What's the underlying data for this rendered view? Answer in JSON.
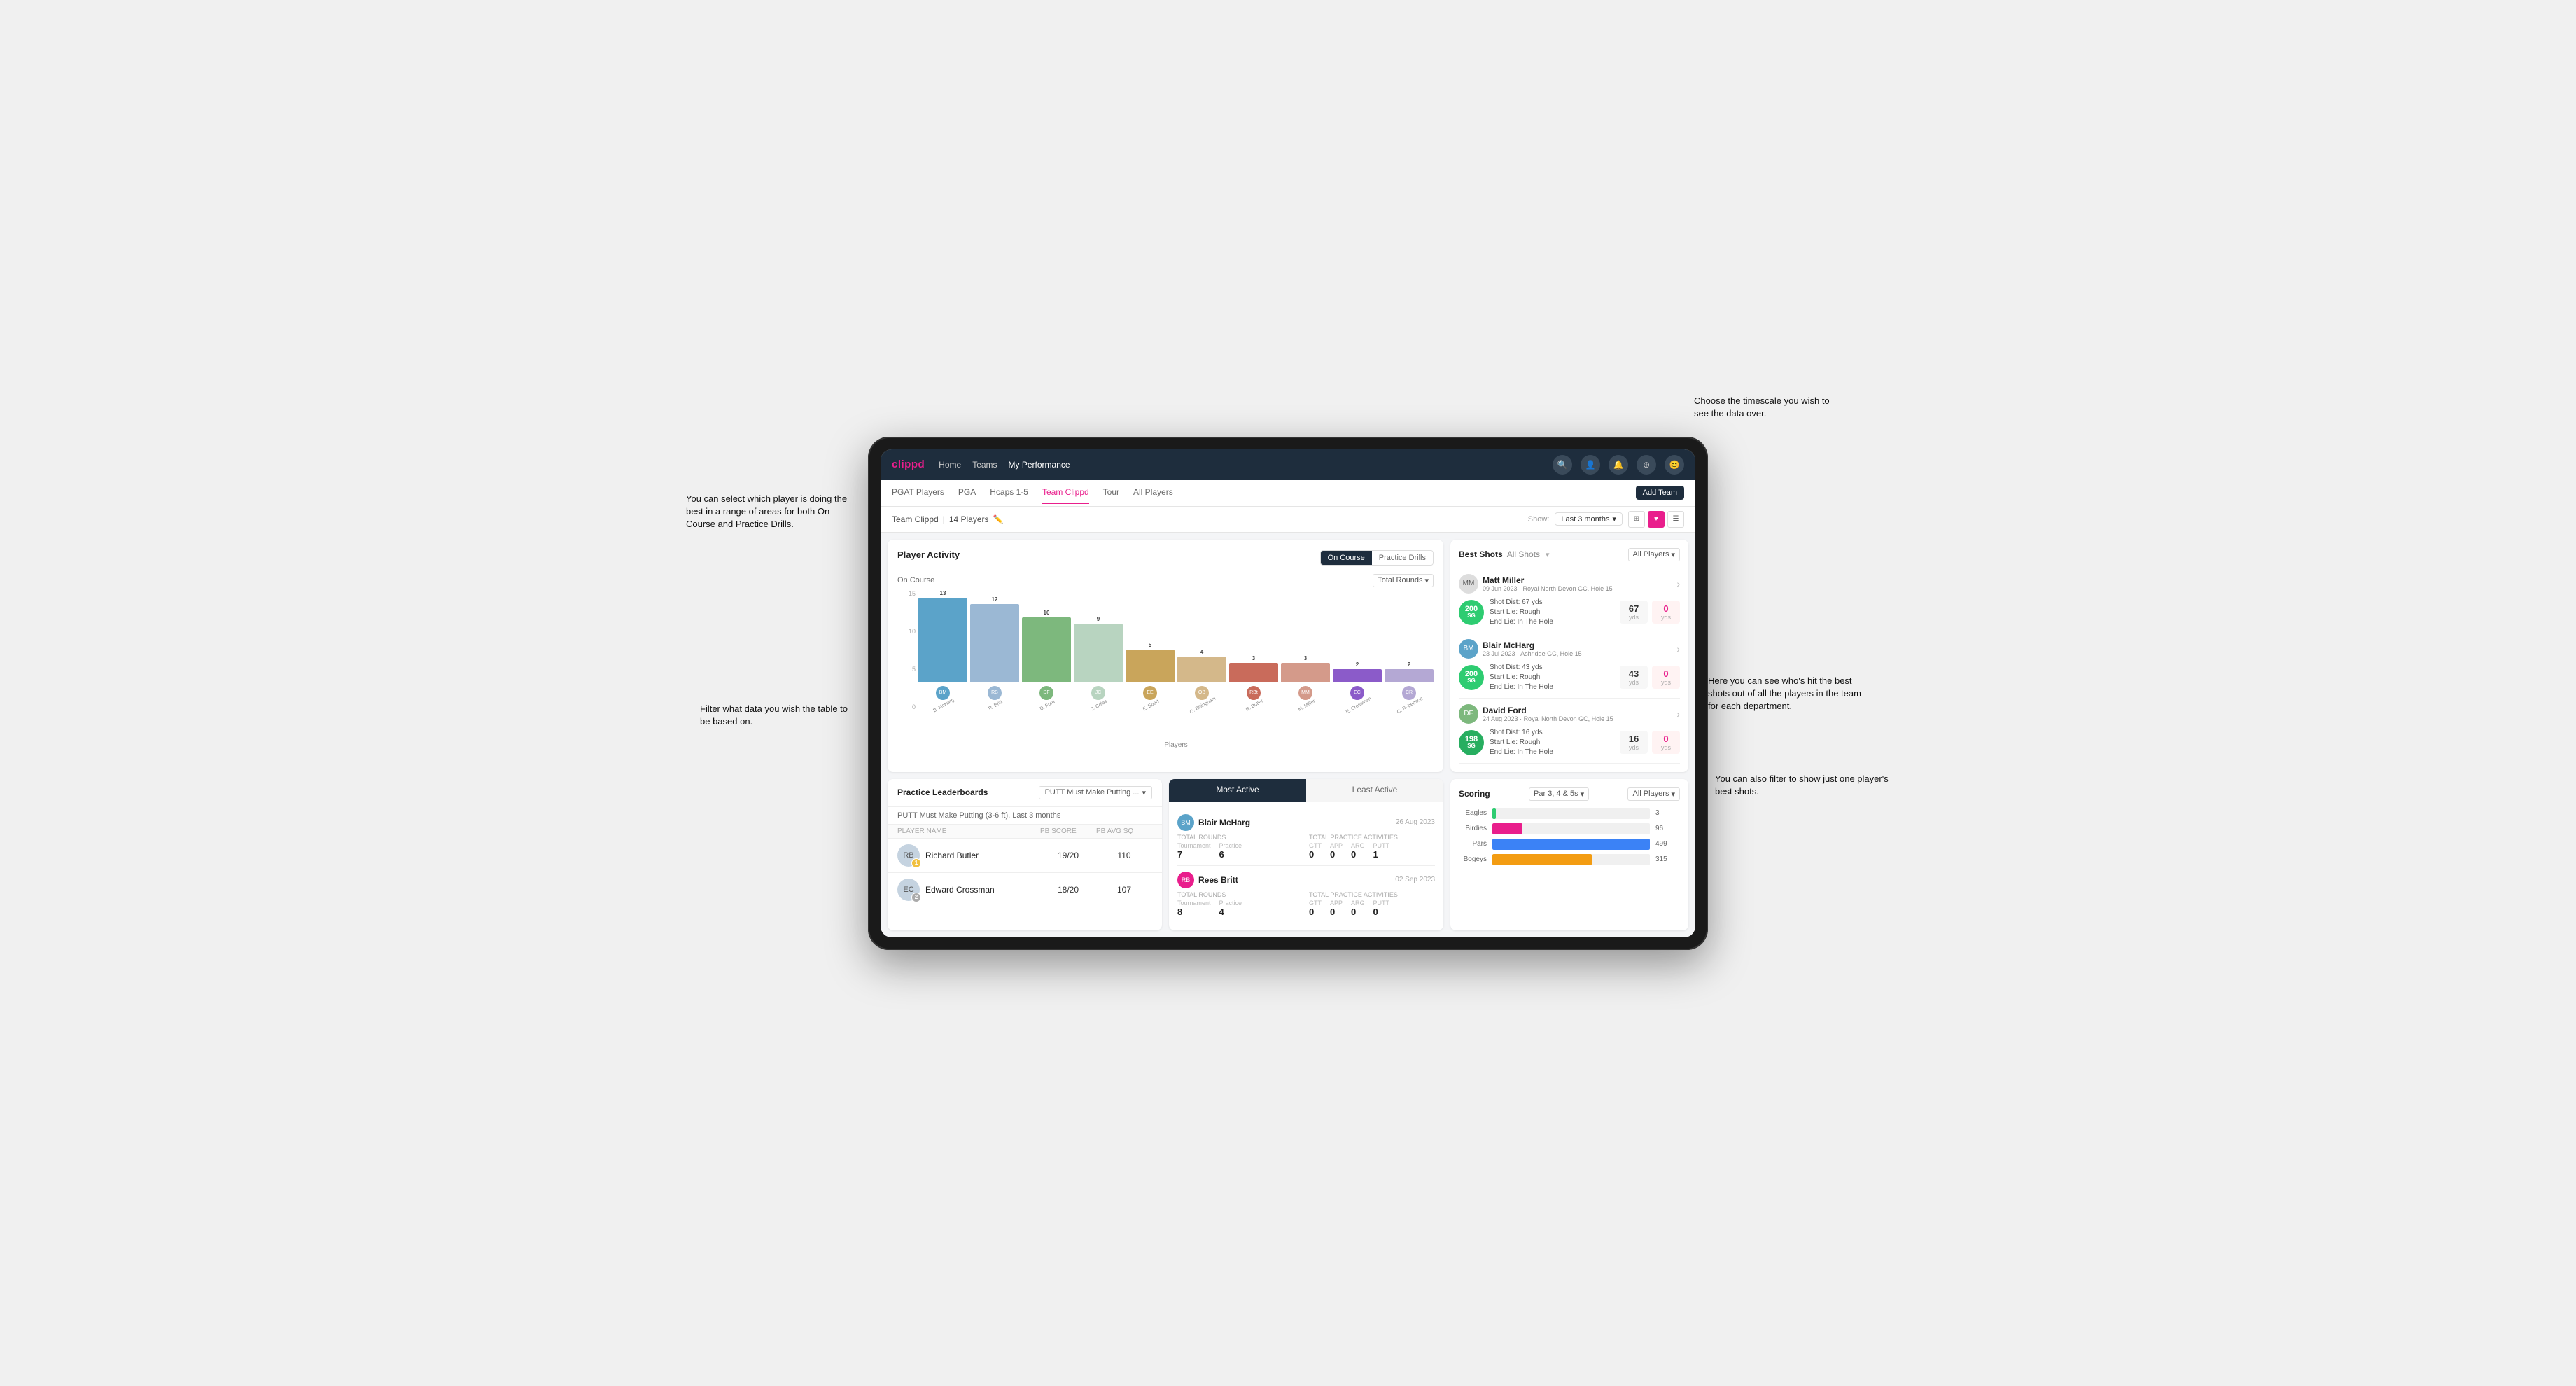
{
  "annotations": {
    "top_right": "Choose the timescale you wish to see the data over.",
    "top_left": "You can select which player is doing the best in a range of areas for both On Course and Practice Drills.",
    "mid_left": "Filter what data you wish the table to be based on.",
    "bottom_right": "Here you can see who's hit the best shots out of all the players in the team for each department.",
    "lower_right": "You can also filter to show just one player's best shots."
  },
  "topbar": {
    "logo": "clippd",
    "nav": [
      "Home",
      "Teams",
      "My Performance"
    ],
    "active_nav": "My Performance"
  },
  "subnav": {
    "tabs": [
      "PGAT Players",
      "PGA",
      "Hcaps 1-5",
      "Team Clippd",
      "Tour",
      "All Players"
    ],
    "active_tab": "Team Clippd",
    "add_button": "Add Team"
  },
  "team_header": {
    "name": "Team Clippd",
    "player_count": "14 Players",
    "show_label": "Show:",
    "months": "Last 3 months",
    "view_modes": [
      "grid",
      "list",
      "heart",
      "filter"
    ]
  },
  "player_activity": {
    "title": "Player Activity",
    "tabs": [
      "On Course",
      "Practice Drills"
    ],
    "active_tab": "On Course",
    "chart_label": "On Course",
    "y_label": "Total Rounds",
    "x_label": "Players",
    "filter": "Total Rounds",
    "y_values": [
      15,
      10,
      5,
      0
    ],
    "bars": [
      {
        "name": "B. McHarg",
        "value": 13,
        "initials": "BM"
      },
      {
        "name": "R. Britt",
        "value": 12,
        "initials": "RB"
      },
      {
        "name": "D. Ford",
        "value": 10,
        "initials": "DF"
      },
      {
        "name": "J. Coles",
        "value": 9,
        "initials": "JC"
      },
      {
        "name": "E. Ebert",
        "value": 5,
        "initials": "EE"
      },
      {
        "name": "O. Billingham",
        "value": 4,
        "initials": "OB"
      },
      {
        "name": "R. Butler",
        "value": 3,
        "initials": "RBt"
      },
      {
        "name": "M. Miller",
        "value": 3,
        "initials": "MM"
      },
      {
        "name": "E. Crossman",
        "value": 2,
        "initials": "EC"
      },
      {
        "name": "C. Robertson",
        "value": 2,
        "initials": "CR"
      }
    ]
  },
  "best_shots": {
    "title": "Best Shots",
    "tabs": [
      "Best Shots",
      "All Shots"
    ],
    "active_tab": "Best Shots",
    "player_filter": "All Players",
    "players": [
      {
        "name": "Matt Miller",
        "date": "09 Jun 2023",
        "course": "Royal North Devon GC",
        "hole": "Hole 15",
        "score": 200,
        "score_label": "SG",
        "shot_dist": "Shot Dist: 67 yds",
        "start_lie": "Start Lie: Rough",
        "end_lie": "End Lie: In The Hole",
        "metric1": 67,
        "metric1_unit": "yds",
        "metric2": 0,
        "metric2_unit": "yds"
      },
      {
        "name": "Blair McHarg",
        "date": "23 Jul 2023",
        "course": "Ashridge GC",
        "hole": "Hole 15",
        "score": 200,
        "score_label": "SG",
        "shot_dist": "Shot Dist: 43 yds",
        "start_lie": "Start Lie: Rough",
        "end_lie": "End Lie: In The Hole",
        "metric1": 43,
        "metric1_unit": "yds",
        "metric2": 0,
        "metric2_unit": "yds"
      },
      {
        "name": "David Ford",
        "date": "24 Aug 2023",
        "course": "Royal North Devon GC",
        "hole": "Hole 15",
        "score": 198,
        "score_label": "SG",
        "shot_dist": "Shot Dist: 16 yds",
        "start_lie": "Start Lie: Rough",
        "end_lie": "End Lie: In The Hole",
        "metric1": 16,
        "metric1_unit": "yds",
        "metric2": 0,
        "metric2_unit": "yds"
      }
    ]
  },
  "practice_leaderboards": {
    "title": "Practice Leaderboards",
    "filter": "PUTT Must Make Putting ...",
    "subtitle": "PUTT Must Make Putting (3-6 ft), Last 3 months",
    "columns": [
      "Player Name",
      "PB Score",
      "PB Avg SQ"
    ],
    "rows": [
      {
        "rank": 1,
        "rank_type": "gold",
        "name": "Richard Butler",
        "initials": "RB",
        "pb_score": "19/20",
        "pb_avg": "110"
      },
      {
        "rank": 2,
        "rank_type": "silver",
        "name": "Edward Crossman",
        "initials": "EC",
        "pb_score": "18/20",
        "pb_avg": "107"
      }
    ]
  },
  "most_active": {
    "tabs": [
      "Most Active",
      "Least Active"
    ],
    "active_tab": "Most Active",
    "players": [
      {
        "name": "Blair McHarg",
        "initials": "BM",
        "date": "26 Aug 2023",
        "total_rounds_label": "Total Rounds",
        "tournament": 7,
        "practice": 6,
        "total_practice_label": "Total Practice Activities",
        "gtt": 0,
        "app": 0,
        "arg": 0,
        "putt": 1
      },
      {
        "name": "Rees Britt",
        "initials": "RB",
        "date": "02 Sep 2023",
        "total_rounds_label": "Total Rounds",
        "tournament": 8,
        "practice": 4,
        "total_practice_label": "Total Practice Activities",
        "gtt": 0,
        "app": 0,
        "arg": 0,
        "putt": 0
      }
    ]
  },
  "scoring": {
    "title": "Scoring",
    "filter1": "Par 3, 4 & 5s",
    "filter2": "All Players",
    "bars": [
      {
        "label": "Eagles",
        "value": 3,
        "max": 500,
        "color": "#2ecc71"
      },
      {
        "label": "Birdies",
        "value": 96,
        "max": 500,
        "color": "#e91e8c"
      },
      {
        "label": "Pars",
        "value": 499,
        "max": 500,
        "color": "#3b82f6"
      },
      {
        "label": "Bogeys",
        "value": 315,
        "max": 500,
        "color": "#f39c12"
      }
    ]
  }
}
